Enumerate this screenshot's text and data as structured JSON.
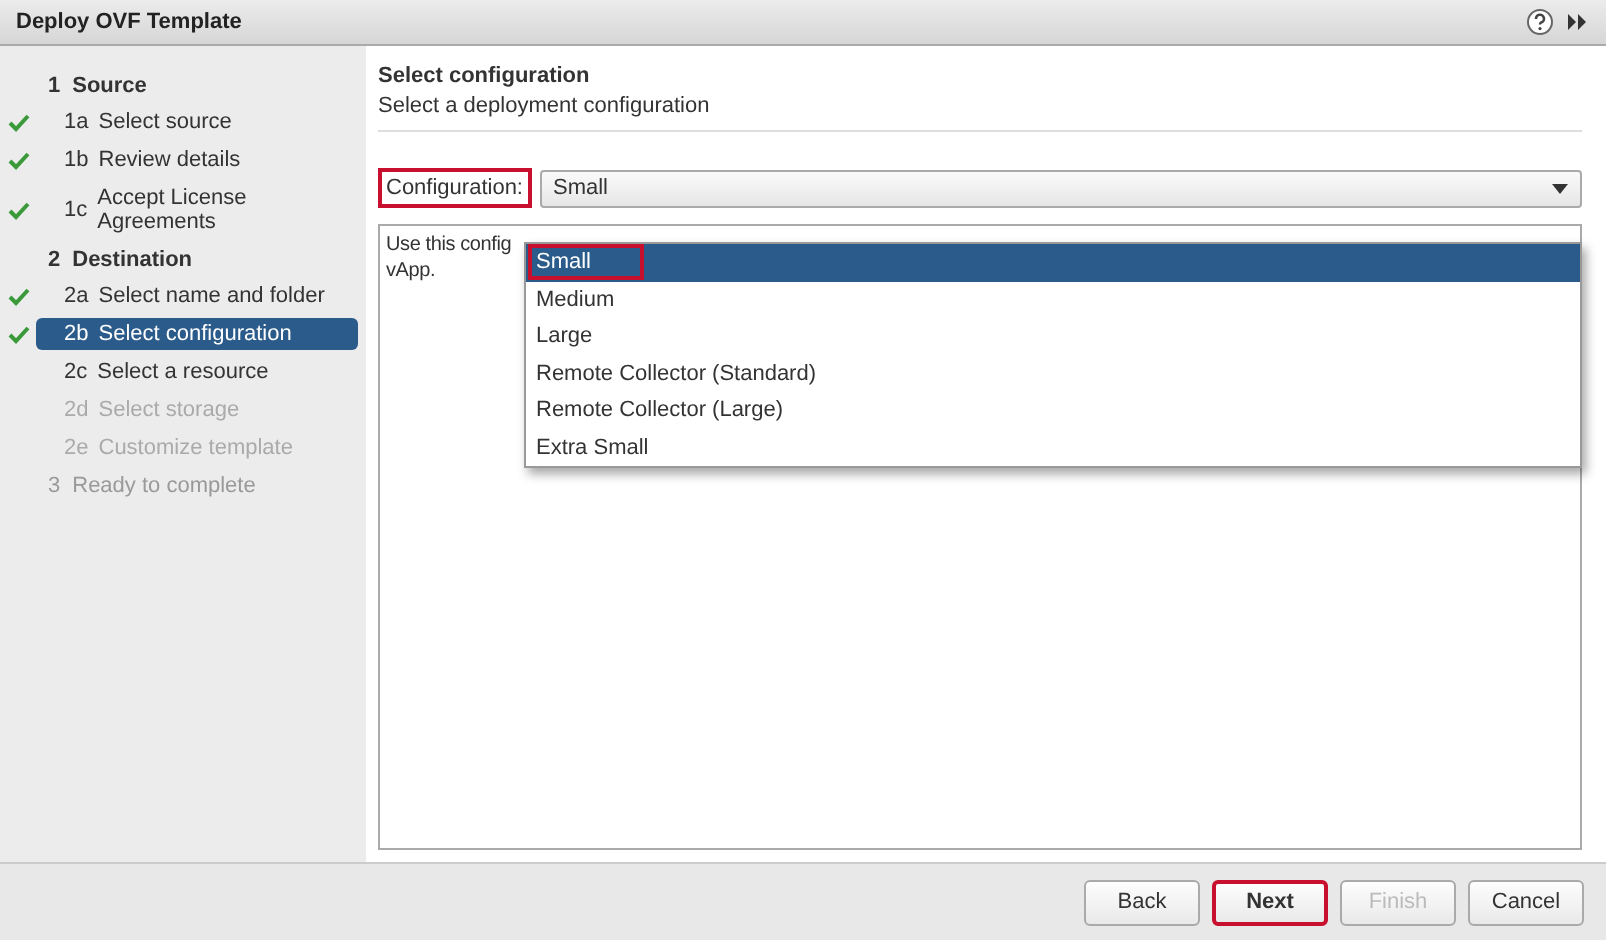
{
  "window": {
    "title": "Deploy OVF Template"
  },
  "steps": [
    {
      "number": "1",
      "label": "Source",
      "disabled": false,
      "children": [
        {
          "number": "1a",
          "label": "Select source",
          "done": true,
          "selected": false,
          "disabled": false
        },
        {
          "number": "1b",
          "label": "Review details",
          "done": true,
          "selected": false,
          "disabled": false
        },
        {
          "number": "1c",
          "label": "Accept License Agreements",
          "done": true,
          "selected": false,
          "disabled": false
        }
      ]
    },
    {
      "number": "2",
      "label": "Destination",
      "disabled": false,
      "children": [
        {
          "number": "2a",
          "label": "Select name and folder",
          "done": true,
          "selected": false,
          "disabled": false
        },
        {
          "number": "2b",
          "label": "Select configuration",
          "done": true,
          "selected": true,
          "disabled": false
        },
        {
          "number": "2c",
          "label": "Select a resource",
          "done": false,
          "selected": false,
          "disabled": false
        },
        {
          "number": "2d",
          "label": "Select storage",
          "done": false,
          "selected": false,
          "disabled": true
        },
        {
          "number": "2e",
          "label": "Customize template",
          "done": false,
          "selected": false,
          "disabled": true
        }
      ]
    },
    {
      "number": "3",
      "label": "Ready to complete",
      "disabled": true
    }
  ],
  "page": {
    "title": "Select configuration",
    "subtitle": "Select a deployment configuration"
  },
  "configuration": {
    "label": "Configuration:",
    "label_highlighted": true,
    "value": "Small",
    "expanded": true,
    "options": [
      {
        "label": "Small",
        "selected": true,
        "highlighted": true
      },
      {
        "label": "Medium",
        "selected": false,
        "highlighted": false
      },
      {
        "label": "Large",
        "selected": false,
        "highlighted": false
      },
      {
        "label": "Remote Collector (Standard)",
        "selected": false,
        "highlighted": false
      },
      {
        "label": "Remote Collector (Large)",
        "selected": false,
        "highlighted": false
      },
      {
        "label": "Extra Small",
        "selected": false,
        "highlighted": false
      }
    ]
  },
  "description": [
    "Use this config",
    "vApp."
  ],
  "buttons": [
    {
      "label": "Back",
      "disabled": false,
      "highlighted": false
    },
    {
      "label": "Next",
      "disabled": false,
      "highlighted": true
    },
    {
      "label": "Finish",
      "disabled": true,
      "highlighted": false
    },
    {
      "label": "Cancel",
      "disabled": false,
      "highlighted": false
    }
  ]
}
